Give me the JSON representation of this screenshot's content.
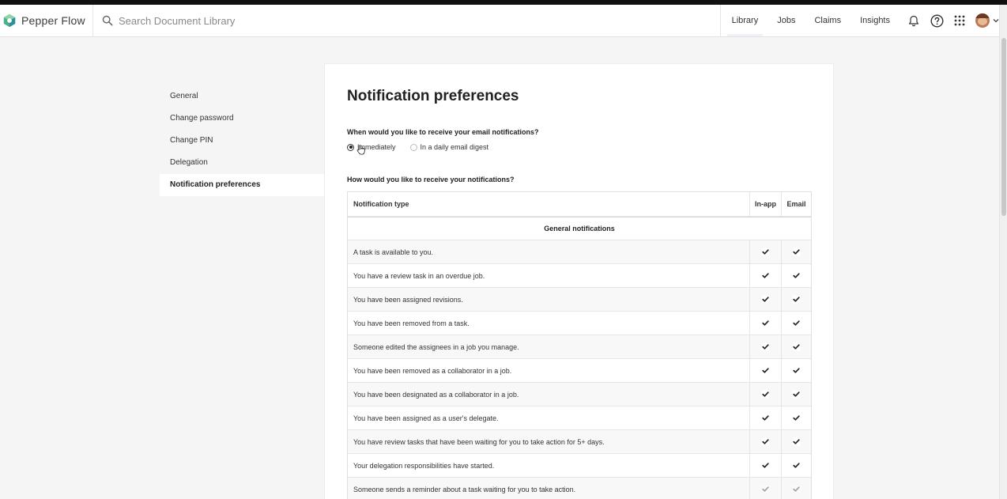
{
  "app": {
    "brand": "Pepper Flow",
    "search_placeholder": "Search Document Library"
  },
  "nav": {
    "items": [
      {
        "label": "Library",
        "active": true
      },
      {
        "label": "Jobs",
        "active": false
      },
      {
        "label": "Claims",
        "active": false
      },
      {
        "label": "Insights",
        "active": false
      }
    ],
    "icons": [
      "bell-icon",
      "help-icon",
      "apps-grid-icon",
      "avatar",
      "chevron-down-icon"
    ]
  },
  "sidebar": {
    "items": [
      {
        "label": "General"
      },
      {
        "label": "Change password"
      },
      {
        "label": "Change PIN"
      },
      {
        "label": "Delegation"
      },
      {
        "label": "Notification preferences",
        "active": true
      }
    ]
  },
  "main": {
    "title": "Notification preferences",
    "email_question": "When would you like to receive your email notifications?",
    "options": [
      {
        "label": "Immediately",
        "selected": true
      },
      {
        "label": "In a daily email digest",
        "selected": false
      }
    ],
    "receive_question": "How would you like to receive your notifications?",
    "table": {
      "headers": {
        "type": "Notification type",
        "inapp": "In-app",
        "email": "Email"
      },
      "section": "General notifications",
      "rows": [
        {
          "text": "A task is available to you.",
          "inapp": true,
          "email": true
        },
        {
          "text": "You have a review task in an overdue job.",
          "inapp": true,
          "email": true
        },
        {
          "text": "You have been assigned revisions.",
          "inapp": true,
          "email": true
        },
        {
          "text": "You have been removed from a task.",
          "inapp": true,
          "email": true
        },
        {
          "text": "Someone edited the assignees in a job you manage.",
          "inapp": true,
          "email": true
        },
        {
          "text": "You have been removed as a collaborator in a job.",
          "inapp": true,
          "email": true
        },
        {
          "text": "You have been designated as a collaborator in a job.",
          "inapp": true,
          "email": true
        },
        {
          "text": "You have been assigned as a user's delegate.",
          "inapp": true,
          "email": true
        },
        {
          "text": "You have review tasks that have been waiting for you to take action for 5+ days.",
          "inapp": true,
          "email": true
        },
        {
          "text": "Your delegation responsibilities have started.",
          "inapp": true,
          "email": true
        },
        {
          "text": "Someone sends a reminder about a task waiting for you to take action.",
          "inapp": true,
          "email": true,
          "disabled": true
        }
      ]
    }
  },
  "colors": {
    "brand_green": "#4caf8a",
    "brand_teal": "#2f8f9d",
    "page_bg": "#f5f5f5",
    "panel_bg": "#ffffff"
  }
}
